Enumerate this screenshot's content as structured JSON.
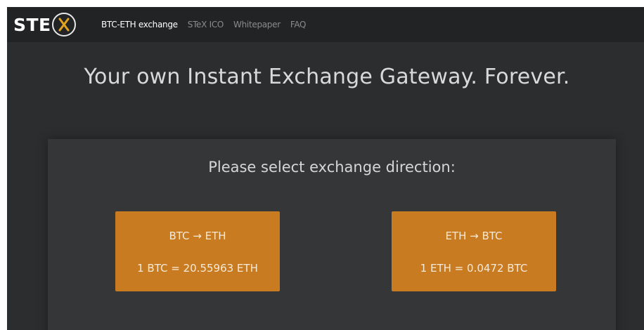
{
  "brand": {
    "logo_text": "STE",
    "logo_mark": "X"
  },
  "nav": {
    "items": [
      {
        "label": "BTC-ETH exchange",
        "active": true
      },
      {
        "label": "STeX ICO",
        "active": false
      },
      {
        "label": "Whitepaper",
        "active": false
      },
      {
        "label": "FAQ",
        "active": false
      }
    ]
  },
  "hero": {
    "title": "Your own Instant Exchange Gateway. Forever."
  },
  "exchange": {
    "prompt": "Please select exchange direction:",
    "directions": [
      {
        "label": "BTC → ETH",
        "rate": "1 BTC = 20.55963 ETH"
      },
      {
        "label": "ETH → BTC",
        "rate": "1 ETH = 0.0472 BTC"
      }
    ]
  },
  "colors": {
    "background": "#2c2d2e",
    "navbar": "#222324",
    "panel": "#353637",
    "accent_button": "#c97b21",
    "logo_x": "#e3a31e"
  }
}
